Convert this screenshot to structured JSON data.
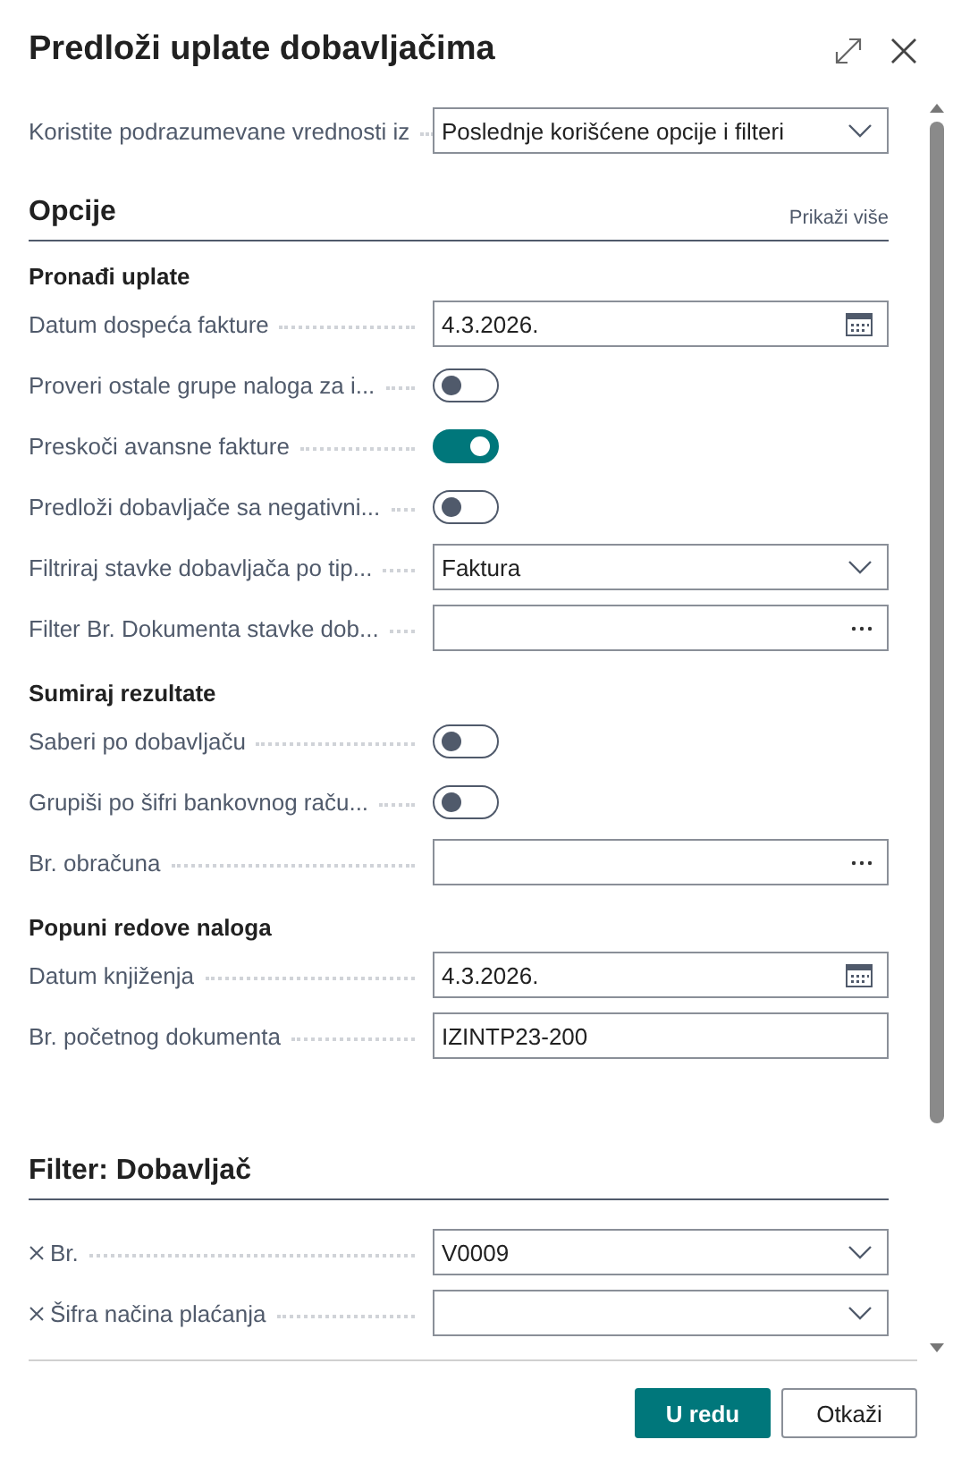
{
  "title": "Predloži uplate dobavljačima",
  "defaults": {
    "label": "Koristite podrazumevane vrednosti iz",
    "value": "Poslednje korišćene opcije i filteri"
  },
  "sections": [
    {
      "title": "Opcije",
      "action": "Prikaži više",
      "groups": [
        {
          "title": "Pronađi uplate",
          "fields": [
            {
              "kind": "date",
              "label": "Datum dospeća fakture",
              "value": "4.3.2026."
            },
            {
              "kind": "toggle",
              "label": "Proveri ostale grupe naloga za i...",
              "on": false
            },
            {
              "kind": "toggle",
              "label": "Preskoči avansne fakture",
              "on": true
            },
            {
              "kind": "toggle",
              "label": "Predloži dobavljače sa negativni...",
              "on": false
            },
            {
              "kind": "select",
              "label": "Filtriraj stavke dobavljača po tip...",
              "value": "Faktura"
            },
            {
              "kind": "lookup",
              "label": "Filter Br. Dokumenta stavke dob..."
            }
          ]
        },
        {
          "title": "Sumiraj rezultate",
          "fields": [
            {
              "kind": "toggle",
              "label": "Saberi po dobavljaču",
              "on": false
            },
            {
              "kind": "toggle",
              "label": "Grupiši po šifri bankovnog raču...",
              "on": false
            },
            {
              "kind": "lookup",
              "label": "Br. obračuna"
            }
          ]
        },
        {
          "title": "Popuni redove naloga",
          "fields": [
            {
              "kind": "date",
              "label": "Datum knjiženja",
              "value": "4.3.2026."
            },
            {
              "kind": "text",
              "label": "Br. početnog dokumenta",
              "value": "IZINTP23-200"
            }
          ]
        }
      ]
    },
    {
      "title": "Filter: Dobavljač",
      "groups": [
        {
          "fields": [
            {
              "kind": "select",
              "label": "Br.",
              "value": "V0009",
              "removable": true
            },
            {
              "kind": "select",
              "label": "Šifra načina plaćanja",
              "removable": true
            }
          ]
        }
      ]
    }
  ],
  "buttons": [
    {
      "label": "U redu",
      "primary": true
    },
    {
      "label": "Otkaži",
      "primary": false
    }
  ]
}
